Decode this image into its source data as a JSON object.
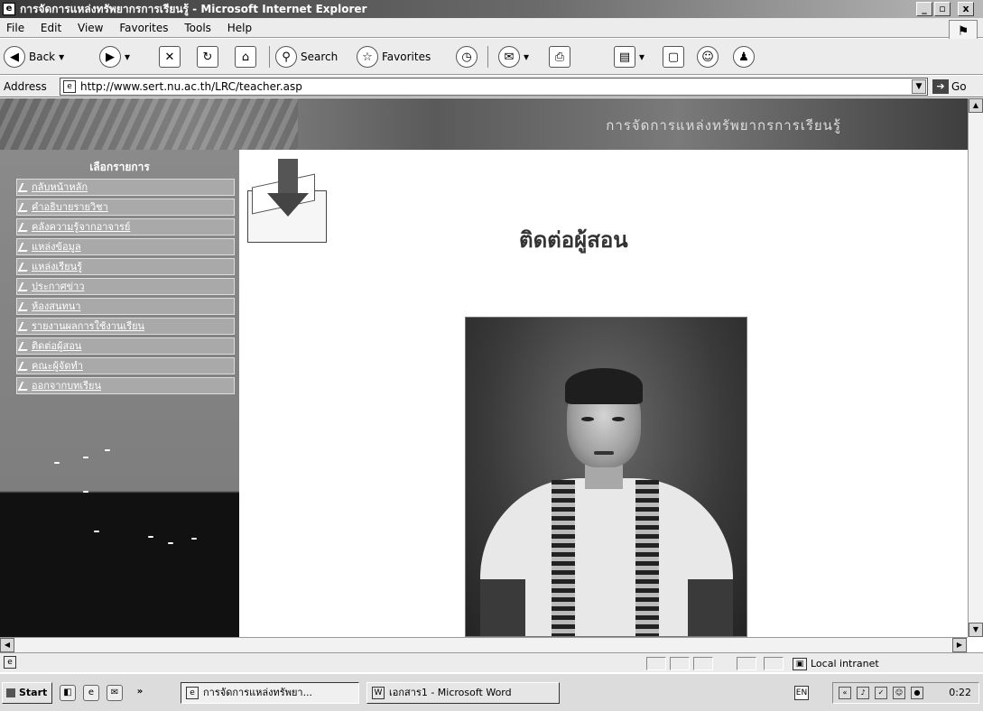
{
  "window": {
    "title": "การจัดการแหล่งทรัพยากรการเรียนรู้ - Microsoft Internet Explorer",
    "controls": [
      "_",
      "▫",
      "x"
    ]
  },
  "menu": [
    "File",
    "Edit",
    "View",
    "Favorites",
    "Tools",
    "Help"
  ],
  "toolbar": {
    "back_label": "Back",
    "search_label": "Search",
    "favorites_label": "Favorites"
  },
  "address": {
    "label": "Address",
    "url": "http://www.sert.nu.ac.th/LRC/teacher.asp",
    "go_label": "Go"
  },
  "banner": {
    "text": "การจัดการแหล่งทรัพยากรการเรียนรู้"
  },
  "sidebar": {
    "heading": "เลือกรายการ",
    "items": [
      "กลับหน้าหลัก",
      "คำอธิบายรายวิชา",
      "คลังความรู้จากอาจารย์",
      "แหล่งข้อมูล",
      "แหล่งเรียนรู้",
      "ประกาศข่าว",
      "ห้องสนทนา",
      "รายงานผลการใช้งานเรียน",
      "ติดต่อผู้สอน",
      "คณะผู้จัดทำ",
      "ออกจากบทเรียน"
    ]
  },
  "main": {
    "title": "ติดต่อผู้สอน"
  },
  "status": {
    "zone": "Local intranet"
  },
  "taskbar": {
    "start_label": "Start",
    "tasks": [
      "การจัดการแหล่งทรัพยา...",
      "เอกสาร1 - Microsoft Word"
    ],
    "clock": "0:22",
    "lang": "EN"
  },
  "colors": {
    "sidebar_bg": "#8a8a8a",
    "titlebar": "#3a3a3a",
    "menu_item_bg": "#a9a9a9"
  }
}
